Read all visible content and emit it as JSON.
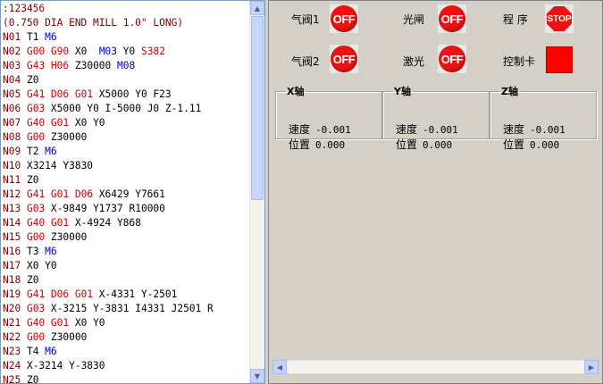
{
  "editor": {
    "lines": [
      [
        [
          "c",
          ":123456"
        ]
      ],
      [
        [
          "c",
          "(0.750 DIA END MILL 1.0\" LONG)"
        ]
      ],
      [
        [
          "ln",
          "N01"
        ],
        [
          "t",
          " T1 "
        ],
        [
          "m",
          "M6"
        ]
      ],
      [
        [
          "ln",
          "N02"
        ],
        [
          "t",
          " "
        ],
        [
          "g",
          "G00 G90"
        ],
        [
          "t",
          " X0  "
        ],
        [
          "m",
          "M03"
        ],
        [
          "t",
          " Y0 "
        ],
        [
          "s",
          "S382"
        ]
      ],
      [
        [
          "ln",
          "N03"
        ],
        [
          "t",
          " "
        ],
        [
          "g",
          "G43 H06"
        ],
        [
          "t",
          " Z30000 "
        ],
        [
          "m",
          "M08"
        ]
      ],
      [
        [
          "ln",
          "N04"
        ],
        [
          "t",
          " Z0"
        ]
      ],
      [
        [
          "ln",
          "N05"
        ],
        [
          "t",
          " "
        ],
        [
          "g",
          "G41 D06 G01"
        ],
        [
          "t",
          " X5000 Y0 F23"
        ]
      ],
      [
        [
          "ln",
          "N06"
        ],
        [
          "t",
          " "
        ],
        [
          "g",
          "G03"
        ],
        [
          "t",
          " X5000 Y0 I-5000 J0 Z-1.11"
        ]
      ],
      [
        [
          "ln",
          "N07"
        ],
        [
          "t",
          " "
        ],
        [
          "g",
          "G40 G01"
        ],
        [
          "t",
          " X0 Y0"
        ]
      ],
      [
        [
          "ln",
          "N08"
        ],
        [
          "t",
          " "
        ],
        [
          "g",
          "G00"
        ],
        [
          "t",
          " Z30000"
        ]
      ],
      [
        [
          "ln",
          "N09"
        ],
        [
          "t",
          " T2 "
        ],
        [
          "m",
          "M6"
        ]
      ],
      [
        [
          "ln",
          "N10"
        ],
        [
          "t",
          " X3214 Y3830"
        ]
      ],
      [
        [
          "ln",
          "N11"
        ],
        [
          "t",
          " Z0"
        ]
      ],
      [
        [
          "ln",
          "N12"
        ],
        [
          "t",
          " "
        ],
        [
          "g",
          "G41 G01 D06"
        ],
        [
          "t",
          " X6429 Y7661"
        ]
      ],
      [
        [
          "ln",
          "N13"
        ],
        [
          "t",
          " "
        ],
        [
          "g",
          "G03"
        ],
        [
          "t",
          " X-9849 Y1737 R10000"
        ]
      ],
      [
        [
          "ln",
          "N14"
        ],
        [
          "t",
          " "
        ],
        [
          "g",
          "G40 G01"
        ],
        [
          "t",
          " X-4924 Y868"
        ]
      ],
      [
        [
          "ln",
          "N15"
        ],
        [
          "t",
          " "
        ],
        [
          "g",
          "G00"
        ],
        [
          "t",
          " Z30000"
        ]
      ],
      [
        [
          "ln",
          "N16"
        ],
        [
          "t",
          " T3 "
        ],
        [
          "m",
          "M6"
        ]
      ],
      [
        [
          "ln",
          "N17"
        ],
        [
          "t",
          " X0 Y0"
        ]
      ],
      [
        [
          "ln",
          "N18"
        ],
        [
          "t",
          " Z0"
        ]
      ],
      [
        [
          "ln",
          "N19"
        ],
        [
          "t",
          " "
        ],
        [
          "g",
          "G41 D06 G01"
        ],
        [
          "t",
          " X-4331 Y-2501"
        ]
      ],
      [
        [
          "ln",
          "N20"
        ],
        [
          "t",
          " "
        ],
        [
          "g",
          "G03"
        ],
        [
          "t",
          " X-3215 Y-3831 I4331 J2501 R"
        ]
      ],
      [
        [
          "ln",
          "N21"
        ],
        [
          "t",
          " "
        ],
        [
          "g",
          "G40 G01"
        ],
        [
          "t",
          " X0 Y0"
        ]
      ],
      [
        [
          "ln",
          "N22"
        ],
        [
          "t",
          " "
        ],
        [
          "g",
          "G00"
        ],
        [
          "t",
          " Z30000"
        ]
      ],
      [
        [
          "ln",
          "N23"
        ],
        [
          "t",
          " T4 "
        ],
        [
          "m",
          "M6"
        ]
      ],
      [
        [
          "ln",
          "N24"
        ],
        [
          "t",
          " X-3214 Y-3830"
        ]
      ],
      [
        [
          "ln",
          "N25"
        ],
        [
          "t",
          " Z0"
        ]
      ]
    ]
  },
  "io": {
    "valve1_label": "气阀1",
    "valve2_label": "气阀2",
    "shutter_label": "光闸",
    "laser_label": "激光",
    "program_label": "程 序",
    "card_label": "控制卡",
    "off_text": "OFF",
    "stop_text": "STOP"
  },
  "axes": [
    {
      "title": "X轴",
      "speed_label": "速度",
      "speed": "-0.001",
      "pos_label": "位置",
      "pos": "0.000"
    },
    {
      "title": "Y轴",
      "speed_label": "速度",
      "speed": "-0.001",
      "pos_label": "位置",
      "pos": "0.000"
    },
    {
      "title": "Z轴",
      "speed_label": "速度",
      "speed": "-0.001",
      "pos_label": "位置",
      "pos": "0.000"
    }
  ],
  "colors": {
    "off_red": "#ee1111",
    "card_status": "#ff0000"
  }
}
